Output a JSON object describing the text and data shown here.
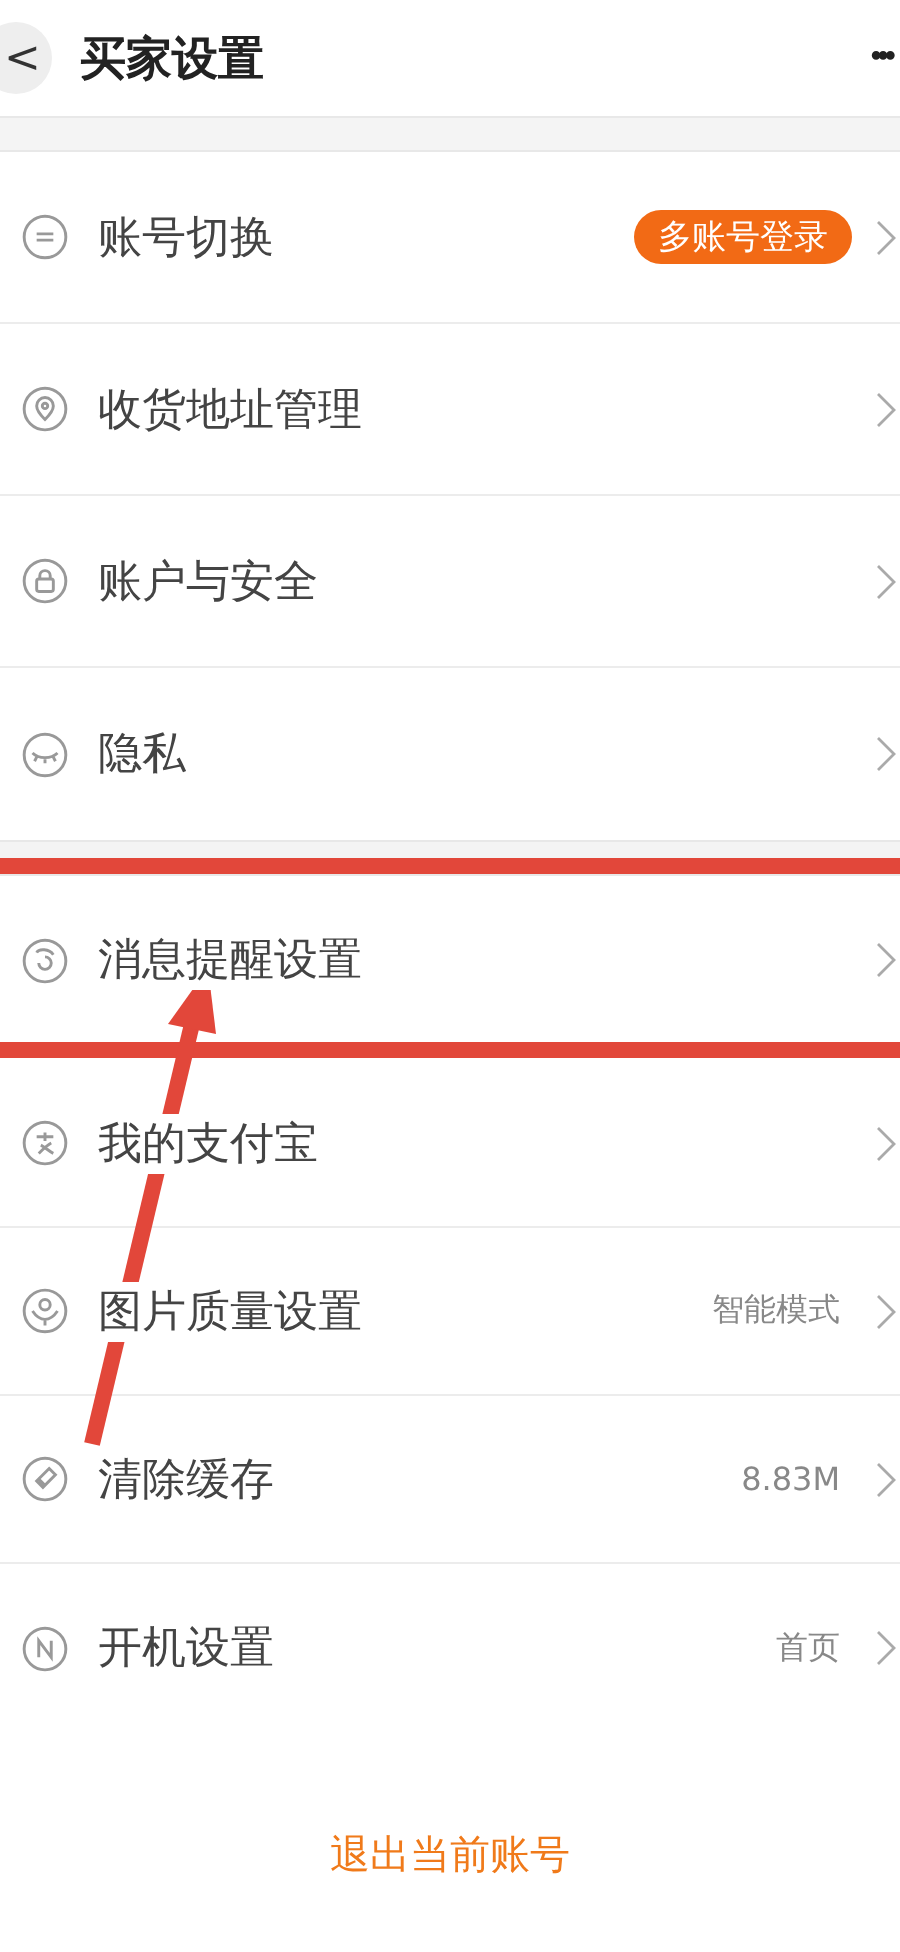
{
  "header": {
    "title": "买家设置",
    "back": "<",
    "more": "•••"
  },
  "sections": [
    {
      "items": [
        {
          "label": "账号切换",
          "kind": "badge",
          "badge": "多账号登录"
        },
        {
          "label": "收货地址管理",
          "kind": "plain"
        },
        {
          "label": "账户与安全",
          "kind": "plain"
        },
        {
          "label": "隐私",
          "kind": "plain"
        }
      ]
    },
    {
      "items": [
        {
          "label": "消息提醒设置",
          "kind": "plain"
        },
        {
          "label": "我的支付宝",
          "kind": "plain"
        },
        {
          "label": "图片质量设置",
          "kind": "value",
          "value": "智能模式"
        },
        {
          "label": "清除缓存",
          "kind": "value",
          "value": "8.83M"
        },
        {
          "label": "开机设置",
          "kind": "value",
          "value": "首页"
        }
      ]
    }
  ],
  "logout": "退出当前账号"
}
